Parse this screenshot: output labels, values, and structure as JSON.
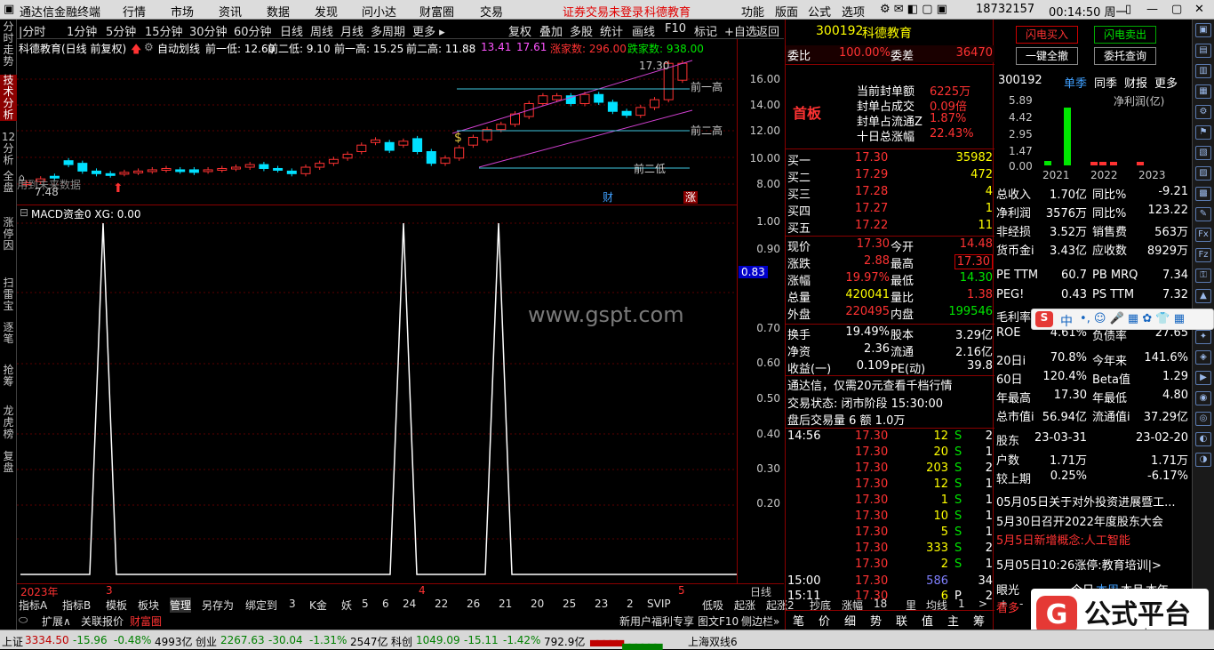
{
  "topbar": {
    "app_title": "通达信金融终端",
    "menus": [
      "行情",
      "市场",
      "资讯",
      "数据",
      "发现",
      "问小达",
      "财富圈",
      "交易"
    ],
    "notice": "证券交易未登录",
    "notice_stock": "科德教育",
    "right_menus": [
      "功能",
      "版面",
      "公式",
      "选项"
    ],
    "account": "18732157",
    "time": "00:14:50 周一"
  },
  "left_tabs": [
    "分时走势",
    "技术分析",
    "12分析",
    "全盘",
    "涨停因",
    "扫雷宝",
    "逐笔",
    "抢筹",
    "龙虎榜",
    "复盘"
  ],
  "toolbar": [
    "分时",
    "1分钟",
    "5分钟",
    "15分钟",
    "30分钟",
    "60分钟",
    "日线",
    "周线",
    "月线",
    "多周期",
    "更多",
    "复权",
    "叠加",
    "多股",
    "统计",
    "画线",
    "F10",
    "标记",
    "+自选",
    "返回"
  ],
  "info": {
    "stock": "科德教育(日线 前复权)",
    "auto": "自动划线",
    "low1": "前一低: 12.60",
    "low2": "前二低: 9.10",
    "high1": "前一高: 15.25",
    "high2": "前二高: 11.88",
    "v1": "13.41",
    "v2": "17.61",
    "up": "涨家数: 296.00",
    "down": "跌家数: 938.00"
  },
  "chart_labels": {
    "peak": "17.30",
    "high1": "前一高",
    "high2": "前二高",
    "low2": "前二低",
    "left": "用到未来数据",
    "left_val": "7.48",
    "cai": "财",
    "zhang": "涨"
  },
  "price_scale": [
    "16.00",
    "14.00",
    "12.00",
    "10.00",
    "8.00"
  ],
  "macd": {
    "title": "MACD资金0 XG: 0.00",
    "scale": [
      "1.00",
      "0.90",
      "0.83",
      "0.70",
      "0.60",
      "0.50",
      "0.40",
      "0.30",
      "0.20"
    ],
    "current": "0.83"
  },
  "date_axis": {
    "year": "2023年",
    "m3": "3",
    "m4": "4",
    "m5": "5",
    "period": "日线"
  },
  "tabs1": [
    "指标A",
    "指标B",
    "模板",
    "板块",
    "管理",
    "另存为",
    "绑定到",
    "3",
    "K金",
    "妖",
    "5",
    "6",
    "24",
    "22",
    "26",
    "21",
    "20",
    "25",
    "23",
    "2",
    "SVIP",
    "低吸",
    "起涨",
    "起涨2",
    "抄底",
    "涨幅",
    "18",
    "里",
    "均线",
    "1",
    ">",
    "+",
    "-"
  ],
  "tabs2": [
    "扩展∧",
    "关联报价",
    "财富圈",
    "新用户福利专享",
    "图文F10",
    "侧边栏»"
  ],
  "quote": {
    "code": "300192",
    "name": "科德教育",
    "weibi_label": "委比",
    "weibi": "100.00%",
    "weicha_label": "委差",
    "weicha": "36470",
    "board": "首板",
    "seal": [
      [
        "当前封单额",
        "6225万"
      ],
      [
        "封单占成交",
        "0.09倍"
      ],
      [
        "封单占流通Z",
        "1.87%"
      ],
      [
        "十日总涨幅",
        "22.43%"
      ]
    ],
    "bids": [
      [
        "买一",
        "17.30",
        "35982"
      ],
      [
        "买二",
        "17.29",
        "472"
      ],
      [
        "买三",
        "17.28",
        "4"
      ],
      [
        "买四",
        "17.27",
        "1"
      ],
      [
        "买五",
        "17.22",
        "11"
      ]
    ],
    "stats": [
      [
        "现价",
        "17.30",
        "今开",
        "14.48"
      ],
      [
        "涨跌",
        "2.88",
        "最高",
        "17.30"
      ],
      [
        "涨幅",
        "19.97%",
        "最低",
        "14.30"
      ],
      [
        "总量",
        "420041",
        "量比",
        "1.38"
      ],
      [
        "外盘",
        "220495",
        "内盘",
        "199546"
      ]
    ],
    "stats2": [
      [
        "换手",
        "19.49%",
        "股本",
        "3.29亿"
      ],
      [
        "净资",
        "2.36",
        "流通",
        "2.16亿"
      ],
      [
        "收益(一)",
        "0.109",
        "PE(动)",
        "39.8"
      ]
    ],
    "ad": "通达信，仅需20元查看千档行情",
    "state": "交易状态: 闭市阶段 15:30:00",
    "after": "盘后交易量 6 额 1.0万",
    "ticks": [
      [
        "14:56",
        "17.30",
        "12",
        "S",
        "2"
      ],
      [
        "",
        "17.30",
        "20",
        "S",
        "1"
      ],
      [
        "",
        "17.30",
        "203",
        "S",
        "2"
      ],
      [
        "",
        "17.30",
        "12",
        "S",
        "1"
      ],
      [
        "",
        "17.30",
        "1",
        "S",
        "1"
      ],
      [
        "",
        "17.30",
        "10",
        "S",
        "1"
      ],
      [
        "",
        "17.30",
        "5",
        "S",
        "1"
      ],
      [
        "",
        "17.30",
        "333",
        "S",
        "2"
      ],
      [
        "",
        "17.30",
        "2",
        "S",
        "1"
      ],
      [
        "15:00",
        "17.30",
        "586",
        "",
        "34"
      ],
      [
        "15:11",
        "17.30",
        "6",
        "P",
        "2"
      ]
    ],
    "bottom_tabs": [
      "笔",
      "价",
      "细",
      "势",
      "联",
      "值",
      "主",
      "筹"
    ]
  },
  "fin": {
    "btn_buy": "闪电买入",
    "btn_sell": "闪电卖出",
    "btn_cancel": "一键全撤",
    "btn_query": "委托查询",
    "code": "300192",
    "tabs": [
      "单季",
      "同季",
      "财报",
      "更多"
    ],
    "bar_title": "净利润(亿)",
    "bar_scale": [
      "5.89",
      "4.42",
      "2.95",
      "1.47",
      "0.00"
    ],
    "years": [
      "2021",
      "2022",
      "2023"
    ],
    "rows": [
      [
        "总收入",
        "1.70亿",
        "同比%",
        "-9.21"
      ],
      [
        "净利润",
        "3576万",
        "同比%",
        "123.22"
      ],
      [
        "非经损",
        "3.52万",
        "销售费",
        "563万"
      ],
      [
        "货币金i",
        "3.43亿",
        "应收数",
        "8929万"
      ],
      [
        "PE TTM",
        "60.7",
        "PB MRQ",
        "7.34"
      ],
      [
        "PEG!",
        "0.43",
        "PS TTM",
        "7.32"
      ],
      [
        "毛利率",
        "",
        "",
        ""
      ],
      [
        "ROE",
        "4.61%",
        "负债率",
        "27.65"
      ],
      [
        "20日i",
        "70.8%",
        "今年来",
        "141.6%"
      ],
      [
        "60日",
        "120.4%",
        "Beta值",
        "1.29"
      ],
      [
        "年最高",
        "17.30",
        "年最低",
        "4.80"
      ],
      [
        "总市值i",
        "56.94亿",
        "流通值i",
        "37.29亿"
      ],
      [
        "股东",
        "23-03-31",
        "",
        "23-02-20"
      ],
      [
        "户数",
        "1.71万",
        "",
        "1.71万"
      ],
      [
        "较上期",
        "0.25%",
        "",
        "-6.17%"
      ]
    ],
    "news": [
      "05月05日关于对外投资进展暨工...",
      "5月30日召开2022年度股东大会",
      "5月5日新增概念:人工智能",
      "5月05日10:26涨停:教育培训|>"
    ],
    "eye": [
      "眼光",
      "今日",
      "本周",
      "本月",
      "本年"
    ],
    "kan": "看多"
  },
  "statusbar": {
    "sh_label": "上证",
    "sh": "3334.50",
    "sh_chg": "-15.96",
    "sh_pct": "-0.48%",
    "sh_amt": "4993亿",
    "cy_label": "创业",
    "cy": "2267.63",
    "cy_chg": "-30.04",
    "cy_pct": "-1.31%",
    "cy_amt": "2547亿",
    "kc_label": "科创",
    "kc": "1049.09",
    "kc_chg": "-15.11",
    "kc_pct": "-1.42%",
    "kc_amt": "792.9亿",
    "right": "上海双线6"
  },
  "watermark": "www.gspt.com",
  "logo": {
    "text": "公式平台",
    "url": "www.gspt.com"
  },
  "ime": "中"
}
